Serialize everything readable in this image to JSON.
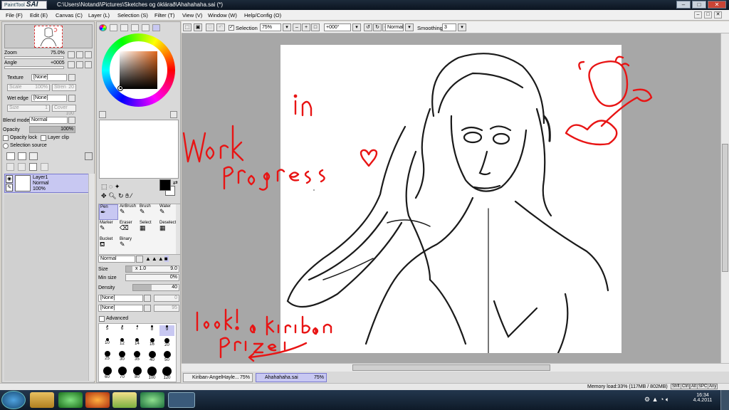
{
  "window": {
    "logo_small": "PaintTool",
    "logo_big": "SAI",
    "title": "C:\\Users\\Notandi\\Pictures\\Sketches og óklárað\\Ahahahaha.sai (*)",
    "min": "–",
    "max": "□",
    "close": "✕"
  },
  "menu": [
    "File (F)",
    "Edit (E)",
    "Canvas (C)",
    "Layer (L)",
    "Selection (S)",
    "Filter (T)",
    "View (V)",
    "Window (W)",
    "Help/Config (O)"
  ],
  "navigator": {
    "zoom_label": "Zoom",
    "zoom_value": "75.0%",
    "angle_label": "Angle",
    "angle_value": "+0005"
  },
  "layer_props": {
    "texture_label": "Texture",
    "texture_value": "[None]",
    "scale_label": "Scale",
    "scale_value": "100%",
    "strength_label": "Stren",
    "strength_value": "20",
    "wet_edge_label": "Wet edge",
    "wet_edge_value": "[None]",
    "size_label": "Size",
    "size_value": "1",
    "cover_label": "Cover",
    "cover_value": "100",
    "blend_label": "Blend mode",
    "blend_value": "Normal",
    "opacity_label": "Opacity",
    "opacity_value": "100%",
    "opacity_lock": "Opacity lock",
    "layer_clip": "Layer clip",
    "selection_source": "Selection source"
  },
  "layers": [
    {
      "name": "Layer1",
      "mode": "Normal",
      "opacity": "100%"
    }
  ],
  "brush": {
    "tools": [
      {
        "label": "Pen",
        "active": true
      },
      {
        "label": "AirBrush"
      },
      {
        "label": "Brush"
      },
      {
        "label": "Water"
      },
      {
        "label": "Marker"
      },
      {
        "label": "Eraser"
      },
      {
        "label": "Select"
      },
      {
        "label": "Deselect"
      },
      {
        "label": "Bucket"
      },
      {
        "label": "Binary"
      }
    ],
    "blend_value": "Normal",
    "size_label": "Size",
    "size_mult": "x 1.0",
    "size_value": "9.0",
    "min_size_label": "Min size",
    "min_size_value": "0%",
    "density_label": "Density",
    "density_value": "40",
    "shape_value": "[None]",
    "shape_num": "0",
    "texture_value": "[None]",
    "texture_num": "95",
    "advanced": "Advanced",
    "dot_sizes": [
      "5",
      "6",
      "7",
      "8",
      "9",
      "10",
      "12",
      "14",
      "16",
      "20",
      "25",
      "30",
      "35",
      "40",
      "50",
      "60",
      "70",
      "80",
      "100",
      "120"
    ]
  },
  "toolbar": {
    "selection_label": "Selection",
    "zoom_value": "75%",
    "rotation_value": "+000°",
    "mode_value": "Normal",
    "smoothing_label": "Smoothing",
    "smoothing_value": "3"
  },
  "tabs": [
    {
      "label": "Kiriban-AngelHayle...",
      "zoom": "75%"
    },
    {
      "label": "Ahahahaha.sai",
      "zoom": "75%",
      "active": true
    }
  ],
  "status": {
    "memory": "Memory load:33% (117MB / 802MB)",
    "keys": [
      "Shft",
      "Ctrl",
      "Alt",
      "SPC",
      "Any"
    ]
  },
  "taskbar": {
    "time": "16:34",
    "date": "4.4.2011"
  },
  "colors": {
    "ink": "#e81414",
    "accent": "#c8c8f2"
  }
}
